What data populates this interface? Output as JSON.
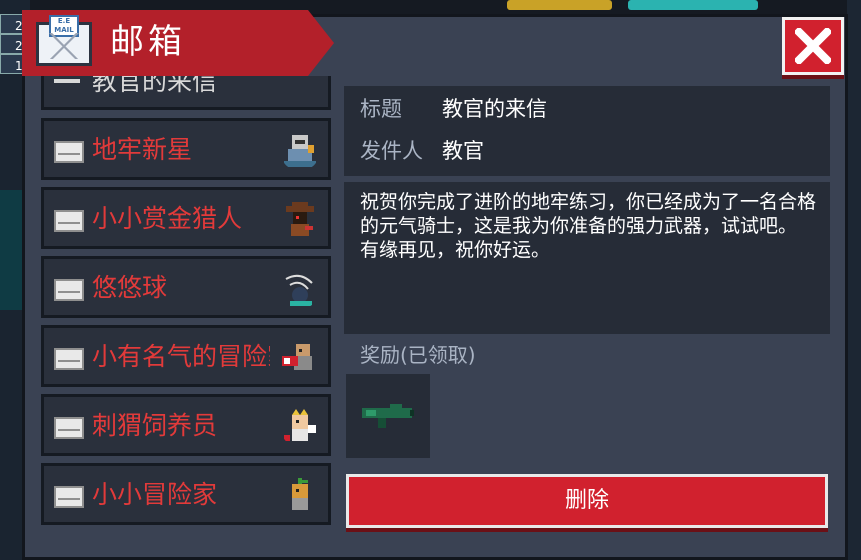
{
  "window": {
    "title": "邮箱",
    "icon": "mail-icon",
    "stamp_text": "E.E MAIL",
    "close_icon": "close-icon"
  },
  "colors": {
    "accent_red": "#d1212e",
    "panel_bg": "#3a4253",
    "item_label": "#e23a3a"
  },
  "mail_list": {
    "partial_item": "教官的来信",
    "items": [
      {
        "label": "地牢新星",
        "avatar": "knight-avatar-icon"
      },
      {
        "label": "小小赏金猎人",
        "avatar": "bounty-hunter-avatar-icon"
      },
      {
        "label": "悠悠球",
        "avatar": "yoyo-avatar-icon"
      },
      {
        "label": "小有名气的冒险家",
        "avatar": "adventurer-avatar-icon"
      },
      {
        "label": "刺猬饲养员",
        "avatar": "hedgehog-keeper-avatar-icon"
      },
      {
        "label": "小小冒险家",
        "avatar": "little-adventurer-avatar-icon"
      }
    ]
  },
  "detail": {
    "title_key": "标题",
    "title_value": "教官的来信",
    "sender_key": "发件人",
    "sender_value": "教官",
    "body": "祝贺你完成了进阶的地牢练习，你已经成为了一名合格的元气骑士，这是我为你准备的强力武器，试试吧。\n有缘再见，祝你好运。",
    "reward_label": "奖励(已领取)",
    "reward_item_icon": "weapon-icon",
    "delete_label": "删除"
  },
  "hud": {
    "left_values": [
      "2",
      "2",
      "1"
    ]
  }
}
